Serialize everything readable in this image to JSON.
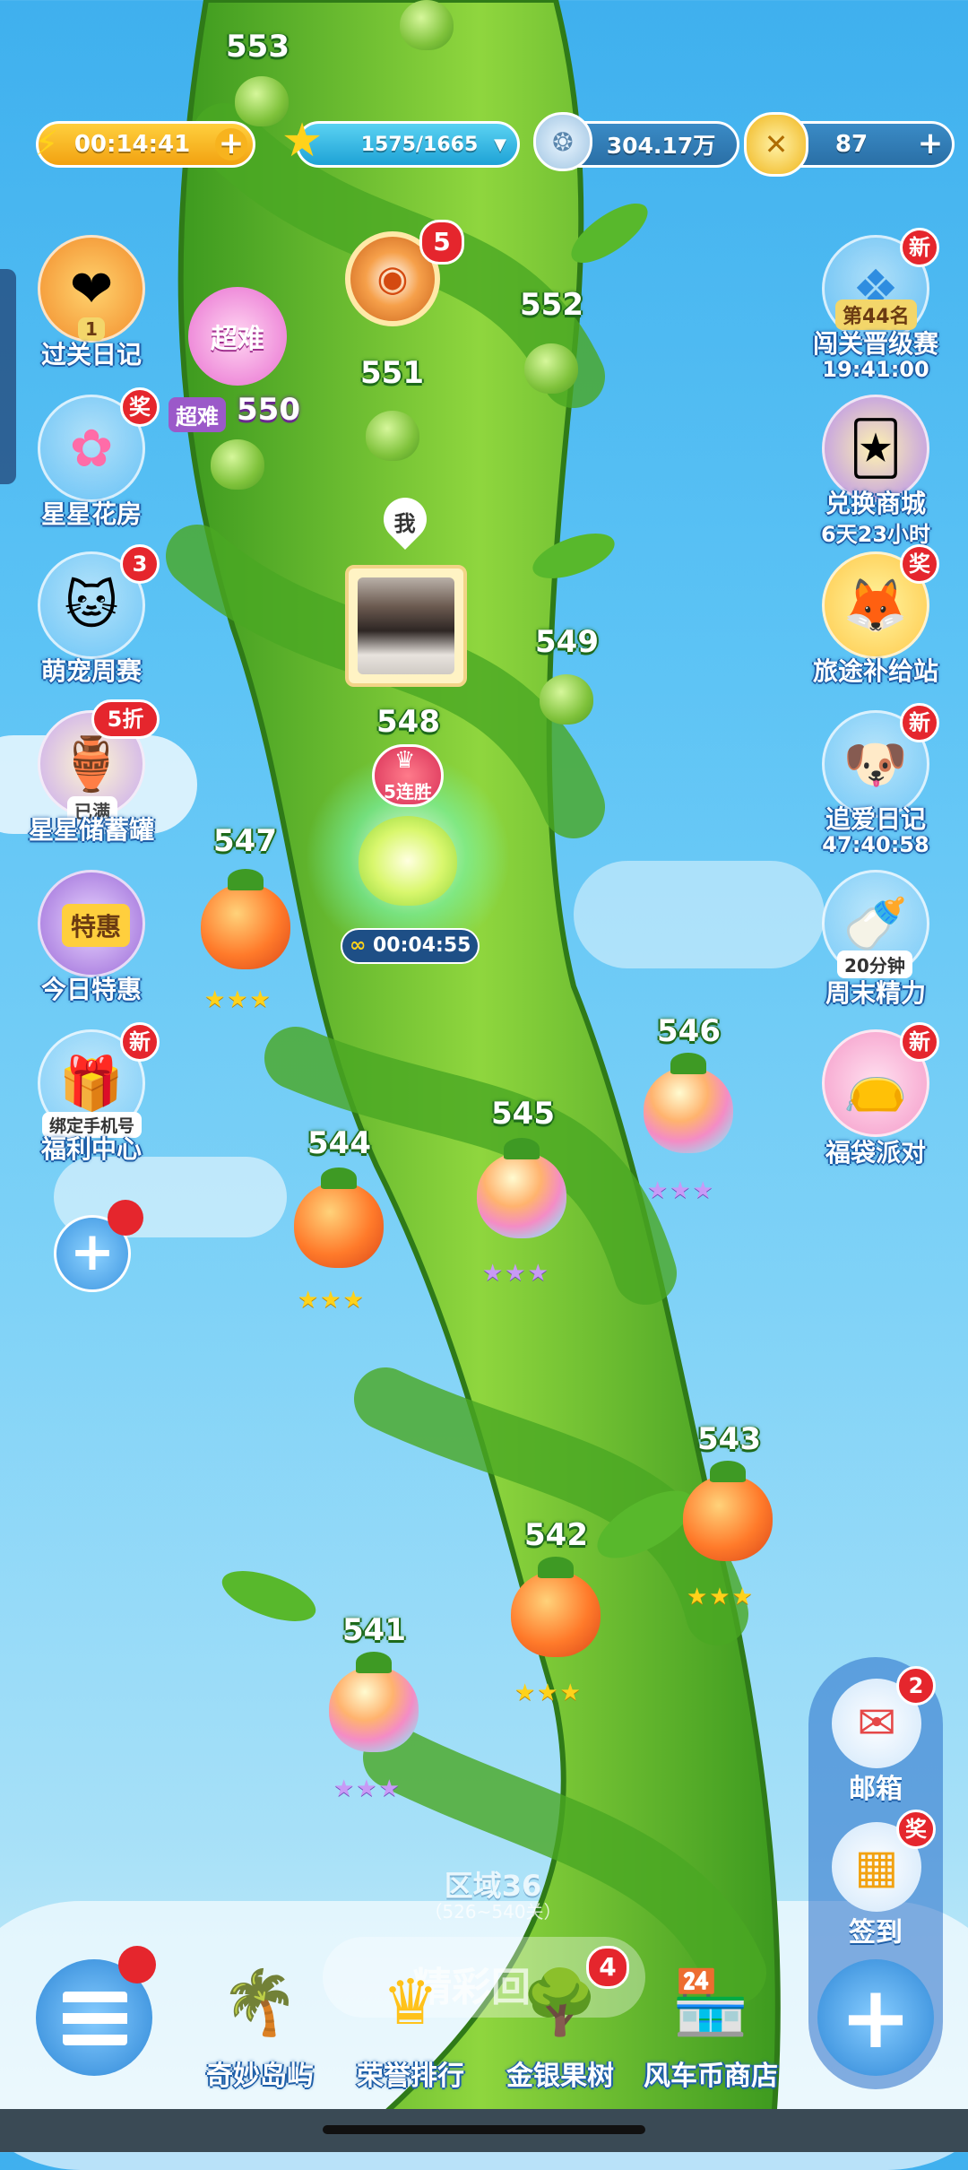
{
  "topbar": {
    "energy_timer": "00:14:41",
    "stars": "1575/1665",
    "coins_silver": "304.17万",
    "coins_gold": "87"
  },
  "left_menu": [
    {
      "label": "过关日记",
      "tag": "1",
      "icon": "diary-heart-icon"
    },
    {
      "label": "星星花房",
      "badge": "奖",
      "icon": "star-flower-icon"
    },
    {
      "label": "萌宠周赛",
      "badge": "3",
      "icon": "cat-icon"
    },
    {
      "label": "星星储蓄罐",
      "badge": "5折",
      "tag": "已满",
      "icon": "piggy-bank-icon"
    },
    {
      "label": "今日特惠",
      "tag": "特惠",
      "icon": "shop-icon"
    },
    {
      "label": "福利中心",
      "badge": "新",
      "tag": "绑定手机号",
      "icon": "gift-icon"
    }
  ],
  "right_menu": [
    {
      "label": "闯关晋级赛",
      "sub": "19:41:00",
      "badge": "新",
      "tag": "第44名",
      "icon": "trophy-icon"
    },
    {
      "label": "兑换商城",
      "sub": "6天23小时",
      "icon": "cards-icon"
    },
    {
      "label": "旅途补给站",
      "badge": "奖",
      "icon": "fox-gift-icon"
    },
    {
      "label": "追爱日记",
      "sub": "47:40:58",
      "badge": "新",
      "icon": "dog-icon"
    },
    {
      "label": "周末精力",
      "tag": "20分钟",
      "icon": "bottle-icon"
    },
    {
      "label": "福袋派对",
      "badge": "新",
      "icon": "lucky-bag-icon"
    }
  ],
  "wheel_badge": "5",
  "super_hard": {
    "flower_label": "超难",
    "tag": "超难",
    "level": "550"
  },
  "me_label": "我",
  "current": {
    "level": "548",
    "streak": "5连胜",
    "timer": "00:04:55"
  },
  "levels": [
    {
      "num": "553",
      "type": "green"
    },
    {
      "num": "552",
      "type": "green"
    },
    {
      "num": "551",
      "type": "green"
    },
    {
      "num": "549",
      "type": "green"
    },
    {
      "num": "547",
      "type": "orange",
      "stars": "gold"
    },
    {
      "num": "546",
      "type": "rainbow",
      "stars": "rb"
    },
    {
      "num": "545",
      "type": "rainbow",
      "stars": "rb"
    },
    {
      "num": "544",
      "type": "orange",
      "stars": "gold"
    },
    {
      "num": "543",
      "type": "orange",
      "stars": "gold"
    },
    {
      "num": "542",
      "type": "orange",
      "stars": "gold"
    },
    {
      "num": "541",
      "type": "rainbow",
      "stars": "rb"
    }
  ],
  "star_glyphs": "★★★",
  "region": {
    "title": "区域36",
    "range": "（526~540关）",
    "banner": "精彩回"
  },
  "right_dock": {
    "mail": {
      "label": "邮箱",
      "badge": "2"
    },
    "checkin": {
      "label": "签到",
      "badge": "奖"
    }
  },
  "bottom_nav": [
    {
      "label": "奇妙岛屿",
      "icon": "palm-island-icon"
    },
    {
      "label": "荣誉排行",
      "icon": "crown-icon"
    },
    {
      "label": "金银果树",
      "icon": "fruit-tree-icon",
      "badge": "4"
    },
    {
      "label": "风车币商店",
      "icon": "windmill-shop-icon"
    }
  ],
  "plus_glyph": "+"
}
